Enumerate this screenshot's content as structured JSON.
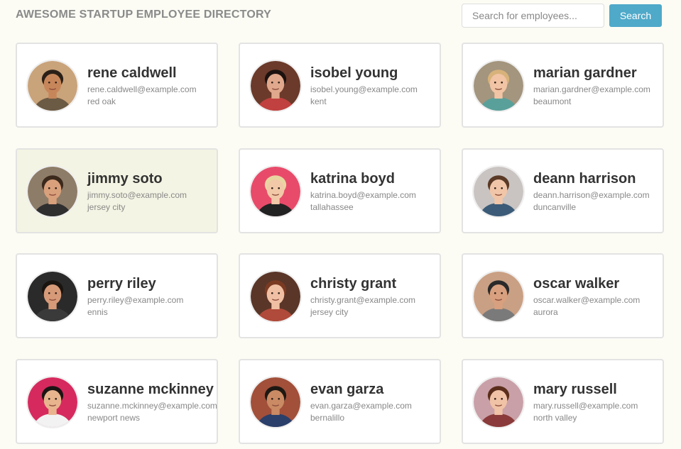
{
  "header": {
    "title": "AWESOME STARTUP EMPLOYEE DIRECTORY",
    "search_placeholder": "Search for employees...",
    "search_button": "Search"
  },
  "employees": [
    {
      "name": "rene caldwell",
      "email": "rene.caldwell@example.com",
      "city": "red oak",
      "bg": "#c9a37a",
      "skin": "#c7865a",
      "hair": "#2a2018",
      "shirt": "#6b5a44"
    },
    {
      "name": "isobel young",
      "email": "isobel.young@example.com",
      "city": "kent",
      "bg": "#6b3a2a",
      "skin": "#e0a88c",
      "hair": "#1c1210",
      "shirt": "#c0413f"
    },
    {
      "name": "marian gardner",
      "email": "marian.gardner@example.com",
      "city": "beaumont",
      "bg": "#a3957e",
      "skin": "#f0c4a4",
      "hair": "#d7b27a",
      "shirt": "#5aa09a"
    },
    {
      "name": "jimmy soto",
      "email": "jimmy.soto@example.com",
      "city": "jersey city",
      "bg": "#8d7c68",
      "skin": "#d9a07c",
      "hair": "#3b2a1c",
      "shirt": "#2f2f2f"
    },
    {
      "name": "katrina boyd",
      "email": "katrina.boyd@example.com",
      "city": "tallahassee",
      "bg": "#e84b6a",
      "skin": "#f2c9a8",
      "hair": "#e8d6a0",
      "shirt": "#222222"
    },
    {
      "name": "deann harrison",
      "email": "deann.harrison@example.com",
      "city": "duncanville",
      "bg": "#c9c4c2",
      "skin": "#f1c6a8",
      "hair": "#5a3a26",
      "shirt": "#3b5b78"
    },
    {
      "name": "perry riley",
      "email": "perry.riley@example.com",
      "city": "ennis",
      "bg": "#2a2a2a",
      "skin": "#d69a78",
      "hair": "#1a1410",
      "shirt": "#3a3a3a"
    },
    {
      "name": "christy grant",
      "email": "christy.grant@example.com",
      "city": "jersey city",
      "bg": "#5a3628",
      "skin": "#f0c0a4",
      "hair": "#7a3a22",
      "shirt": "#b04a3a"
    },
    {
      "name": "oscar walker",
      "email": "oscar.walker@example.com",
      "city": "aurora",
      "bg": "#c9a084",
      "skin": "#d8a07e",
      "hair": "#2a2a2a",
      "shirt": "#7a7a7a"
    },
    {
      "name": "suzanne mckinney",
      "email": "suzanne.mckinney@example.com",
      "city": "newport news",
      "bg": "#d62a5e",
      "skin": "#e8b48e",
      "hair": "#1c1414",
      "shirt": "#f2f2f2"
    },
    {
      "name": "evan garza",
      "email": "evan.garza@example.com",
      "city": "bernalillo",
      "bg": "#a2503a",
      "skin": "#c98a64",
      "hair": "#1e1812",
      "shirt": "#2a3f6a"
    },
    {
      "name": "mary russell",
      "email": "mary.russell@example.com",
      "city": "north valley",
      "bg": "#c9a0a8",
      "skin": "#f0c2a6",
      "hair": "#5a2e1a",
      "shirt": "#8a3a3a"
    }
  ],
  "highlighted_index": 3
}
